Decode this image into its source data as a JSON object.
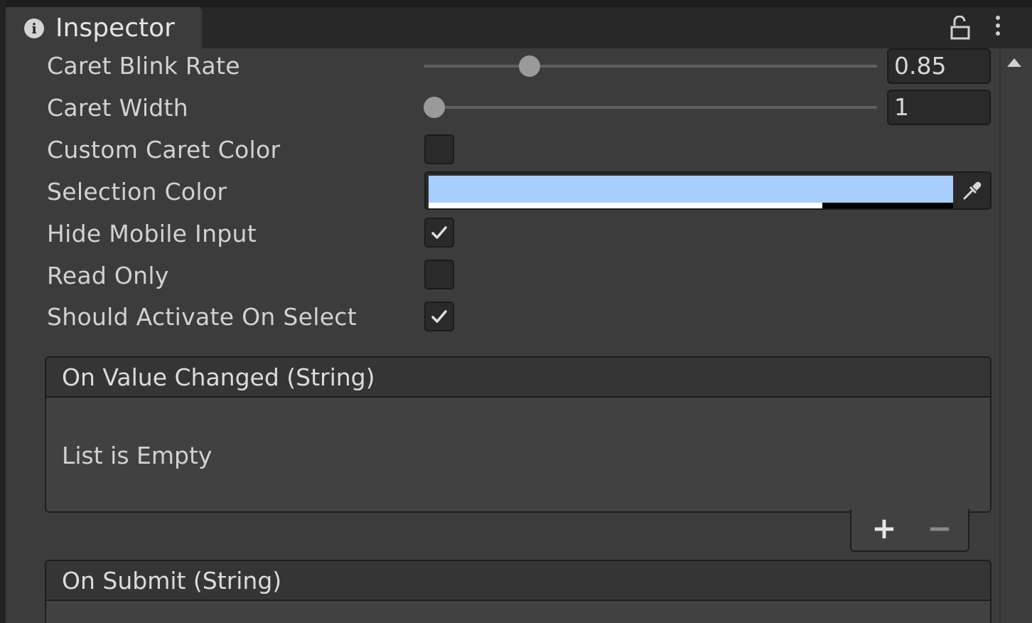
{
  "window": {
    "tab_title": "Inspector",
    "tab_icon": "info-icon",
    "header_icons": [
      "lock-icon",
      "kebab-menu-icon"
    ]
  },
  "fields": {
    "caret_blink_rate": {
      "label": "Caret Blink Rate",
      "value": "0.85",
      "slider_fraction": 0.22
    },
    "caret_width": {
      "label": "Caret Width",
      "value": "1",
      "slider_fraction": 0.0
    },
    "custom_caret_color": {
      "label": "Custom Caret Color",
      "checked": false
    },
    "selection_color": {
      "label": "Selection Color",
      "color": "#a8cefe",
      "alpha_fraction": 0.75
    },
    "hide_mobile_input": {
      "label": "Hide Mobile Input",
      "checked": true
    },
    "read_only": {
      "label": "Read Only",
      "checked": false
    },
    "should_activate_on_select": {
      "label": "Should Activate On Select",
      "checked": true
    }
  },
  "events": {
    "on_value_changed": {
      "title": "On Value Changed (String)",
      "empty_text": "List is Empty"
    },
    "on_submit": {
      "title": "On Submit (String)"
    }
  },
  "list_controls": {
    "add": "+",
    "remove": "−"
  },
  "colors": {
    "background": "#3c3c3c",
    "tabbar": "#282828",
    "field_bg": "#2a2a2a",
    "text": "#d2d2d2",
    "selection_color": "#a8cefe"
  }
}
